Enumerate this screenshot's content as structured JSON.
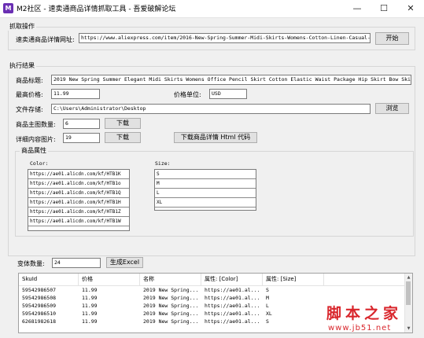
{
  "window": {
    "app_icon_text": "M",
    "title": "M2社区 - 速卖通商品详情抓取工具 - 吾爱破解论坛",
    "min_glyph": "—",
    "max_glyph": "☐",
    "close_glyph": "✕"
  },
  "grab": {
    "group_title": "抓取操作",
    "url_label": "速卖通商品详情网址:",
    "url_value": "https://www.aliexpress.com/item/2016-New-Spring-Summer-Midi-Skirts-Womens-Cotton-Linen-Casual-M",
    "start_button": "开始"
  },
  "result": {
    "group_title": "执行结果",
    "title_label": "商品标题:",
    "title_value": "2019 New Spring Summer Elegant Midi Skirts Womens Office Pencil Skirt Cotton Elastic Waist Package Hip Skirt Bow Skir",
    "max_price_label": "最高价格:",
    "max_price_value": "11.99",
    "currency_label": "价格单位:",
    "currency_value": "USD",
    "save_label": "文件存储:",
    "save_value": "C:\\Users\\Administrator\\Desktop",
    "browse_button": "浏览",
    "main_img_label": "商品主图数量:",
    "main_img_value": "6",
    "download_button_1": "下载",
    "detail_img_label": "详细内容图片:",
    "detail_img_value": "19",
    "download_button_2": "下载",
    "download_html_button": "下载商品详情 Html 代码"
  },
  "attrs": {
    "group_title": "商品属性",
    "color_label": "Color:",
    "colors": [
      "https://ae01.alicdn.com/kf/HTB1K",
      "https://ae01.alicdn.com/kf/HTB1o",
      "https://ae01.alicdn.com/kf/HTB1Q",
      "https://ae01.alicdn.com/kf/HTB1H",
      "https://ae01.alicdn.com/kf/HTB1Z",
      "https://ae01.alicdn.com/kf/HTB1W"
    ],
    "size_label": "Size:",
    "sizes": [
      "S",
      "M",
      "L",
      "XL"
    ]
  },
  "variants": {
    "count_label": "变体数量:",
    "count_value": "24",
    "generate_button": "生成Excel"
  },
  "table": {
    "columns": [
      "SkuId",
      "价格",
      "名称",
      "属性: [Color]",
      "属性: [Size]"
    ],
    "rows": [
      [
        "59542986507",
        "11.99",
        "2019 New Spring...",
        "https://ae01.al...",
        "S"
      ],
      [
        "59542986508",
        "11.99",
        "2019 New Spring...",
        "https://ae01.al...",
        "M"
      ],
      [
        "59542986509",
        "11.99",
        "2019 New Spring...",
        "https://ae01.al...",
        "L"
      ],
      [
        "59542986510",
        "11.99",
        "2019 New Spring...",
        "https://ae01.al...",
        "XL"
      ],
      [
        "62681982618",
        "11.99",
        "2019 New Spring...",
        "https://ae01.al...",
        "S"
      ]
    ],
    "scroll_up": "▲",
    "scroll_down": "▼"
  },
  "watermark": {
    "text": "脚本之家",
    "url": "www.jb51.net"
  }
}
